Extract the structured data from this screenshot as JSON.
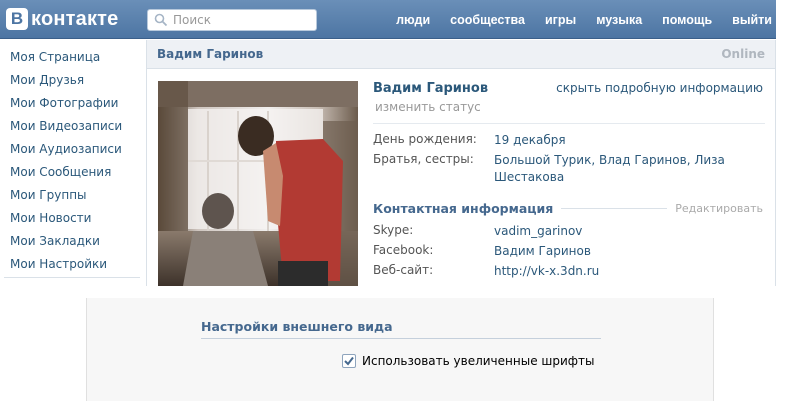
{
  "header": {
    "logo_letter": "В",
    "logo_text": "контакте",
    "search_placeholder": "Поиск",
    "nav": [
      "люди",
      "сообщества",
      "игры",
      "музыка",
      "помощь",
      "выйти"
    ]
  },
  "sidebar": {
    "items": [
      "Моя Страница",
      "Мои Друзья",
      "Мои Фотографии",
      "Мои Видеозаписи",
      "Мои Аудиозаписи",
      "Мои Сообщения",
      "Мои Группы",
      "Мои Новости",
      "Мои Закладки",
      "Мои Настройки"
    ]
  },
  "profile": {
    "header_name": "Вадим Гаринов",
    "online": "Online",
    "name": "Вадим Гаринов",
    "change_status": "изменить статус",
    "hide_details": "скрыть подробную информацию",
    "birthday_label": "День рождения:",
    "birthday_value": "19 декабря",
    "siblings_label": "Братья, сестры:",
    "siblings_value": "Большой Турик, Влад Гаринов, Лиза Шестакова",
    "contact_title": "Контактная информация",
    "edit": "Редактировать",
    "skype_label": "Skype:",
    "skype_value": "vadim_garinov",
    "facebook_label": "Facebook:",
    "facebook_value": "Вадим Гаринов",
    "website_label": "Веб-сайт:",
    "website_value": "http://vk-x.3dn.ru"
  },
  "settings": {
    "title": "Настройки внешнего вида",
    "large_fonts_label": "Использовать увеличенные шрифты",
    "large_fonts_checked": true
  },
  "colors": {
    "header_blue": "#4d75a3",
    "link_blue": "#2b587a",
    "title_blue": "#45688e"
  }
}
